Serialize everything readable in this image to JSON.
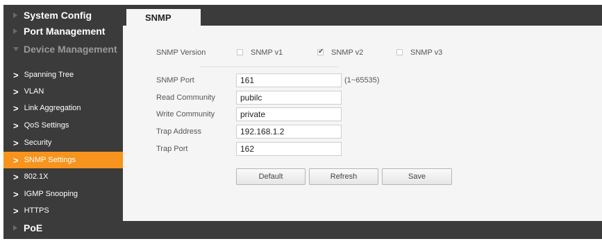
{
  "sidebar": {
    "top": [
      {
        "label": "System Config"
      },
      {
        "label": "Port Management"
      },
      {
        "label": "Device Management"
      }
    ],
    "sub": [
      {
        "label": "Spanning Tree"
      },
      {
        "label": "VLAN"
      },
      {
        "label": "Link Aggregation"
      },
      {
        "label": "QoS Settings"
      },
      {
        "label": "Security"
      },
      {
        "label": "SNMP Settings"
      },
      {
        "label": "802.1X"
      },
      {
        "label": "IGMP Snooping"
      },
      {
        "label": "HTTPS"
      }
    ],
    "bottom": {
      "label": "PoE"
    }
  },
  "tab": {
    "label": "SNMP"
  },
  "version": {
    "label": "SNMP Version",
    "options": [
      {
        "label": "SNMP v1",
        "checked": false
      },
      {
        "label": "SNMP v2",
        "checked": true
      },
      {
        "label": "SNMP v3",
        "checked": false
      }
    ]
  },
  "fields": {
    "port": {
      "label": "SNMP Port",
      "value": "161",
      "hint": "(1~65535)"
    },
    "read_community": {
      "label": "Read Community",
      "value": "pubilc"
    },
    "write_community": {
      "label": "Write Community",
      "value": "private"
    },
    "trap_address": {
      "label": "Trap Address",
      "value": "192.168.1.2"
    },
    "trap_port": {
      "label": "Trap Port",
      "value": "162"
    }
  },
  "buttons": {
    "default": "Default",
    "refresh": "Refresh",
    "save": "Save"
  },
  "colors": {
    "accent": "#f7941d",
    "sidebar_bg": "#3b3b3b",
    "panel_bg": "#f5f5f5"
  }
}
